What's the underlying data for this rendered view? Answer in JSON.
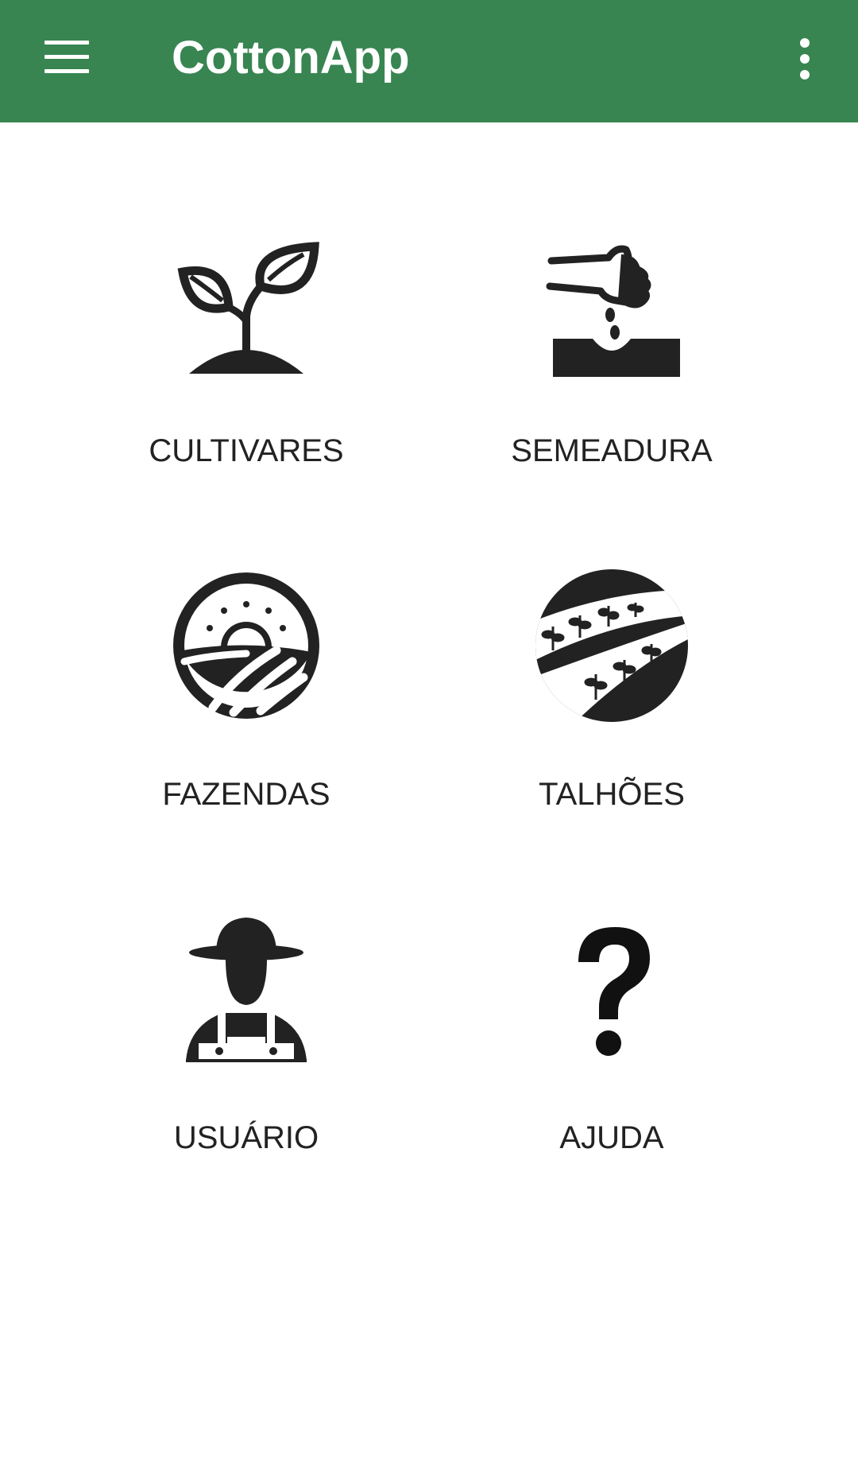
{
  "appbar": {
    "title": "CottonApp",
    "background_color": "#388552",
    "menu_icon": "hamburger-menu-icon",
    "overflow_icon": "more-vertical-icon"
  },
  "grid": {
    "label_color": "#222222",
    "items": [
      {
        "label": "CULTIVARES",
        "icon": "seedling-icon"
      },
      {
        "label": "SEMEADURA",
        "icon": "sowing-hand-icon"
      },
      {
        "label": "FAZENDAS",
        "icon": "farm-sunrise-icon"
      },
      {
        "label": "TALHÕES",
        "icon": "field-plots-icon"
      },
      {
        "label": "USUÁRIO",
        "icon": "farmer-icon"
      },
      {
        "label": "AJUDA",
        "icon": "question-mark-icon"
      }
    ]
  }
}
